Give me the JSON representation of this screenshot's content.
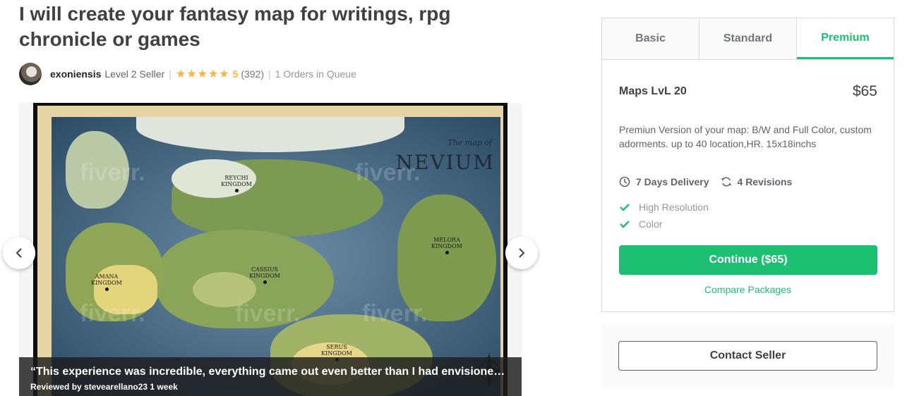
{
  "gig": {
    "title": "I will create your fantasy map for writings, rpg chronicle or games"
  },
  "seller": {
    "name": "exoniensis",
    "level": "Level 2 Seller",
    "rating": "5",
    "reviews": "(392)",
    "queue": "1 Orders in Queue",
    "stars": "★★★★★"
  },
  "gallery": {
    "map": {
      "heading_small": "The map of",
      "heading": "NEVIUM",
      "watermark": "fiverr.",
      "kingdoms": [
        "REYCHI KINGDOM",
        "MELORA KINGDOM",
        "AMANA KINGDOM",
        "CASSIUS KINGDOM",
        "SERUS KINGDOM"
      ]
    },
    "review": {
      "quote": "“This experience was incredible, everything came out even better than I had envisioned. Thank you so much!",
      "meta": "Reviewed by stevearellano23 1 week"
    }
  },
  "packages": {
    "tabs": [
      "Basic",
      "Standard",
      "Premium"
    ],
    "active_tab": "Premium",
    "name": "Maps LvL 20",
    "price": "$65",
    "description": "Premiun Version of your map: B/W and Full Color, custom adorments. up to 40 location,HR. 15x18inchs",
    "delivery": "7 Days Delivery",
    "revisions": "4 Revisions",
    "features": [
      "High Resolution",
      "Color"
    ],
    "continue_label": "Continue ($65)",
    "compare_label": "Compare Packages"
  },
  "contact": {
    "label": "Contact Seller"
  },
  "colors": {
    "brand_green": "#1dbf73",
    "star_gold": "#ffb33e",
    "text_dark": "#404145"
  }
}
